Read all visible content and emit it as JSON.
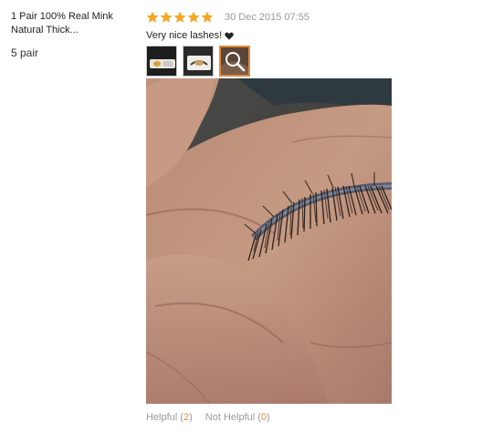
{
  "product": {
    "title": "1 Pair 100% Real Mink Natural Thick...",
    "variant": "5 pair"
  },
  "review": {
    "rating": 5,
    "rating_max": 5,
    "date": "30 Dec 2015 07:55",
    "text": "Very nice lashes!",
    "thumbnails": [
      {
        "name": "lash-case-thumbnail",
        "selected": false
      },
      {
        "name": "lash-box-thumbnail",
        "selected": false
      },
      {
        "name": "magnify-thumbnail",
        "selected": true
      }
    ]
  },
  "helpful": {
    "label": "Helpful",
    "count": "2",
    "not_label": "Not Helpful",
    "not_count": "0"
  },
  "colors": {
    "star": "#f5a623",
    "accent": "#e08a3c",
    "muted": "#999999"
  },
  "icons": [
    "star-icon",
    "heart-icon",
    "magnifier-icon"
  ]
}
